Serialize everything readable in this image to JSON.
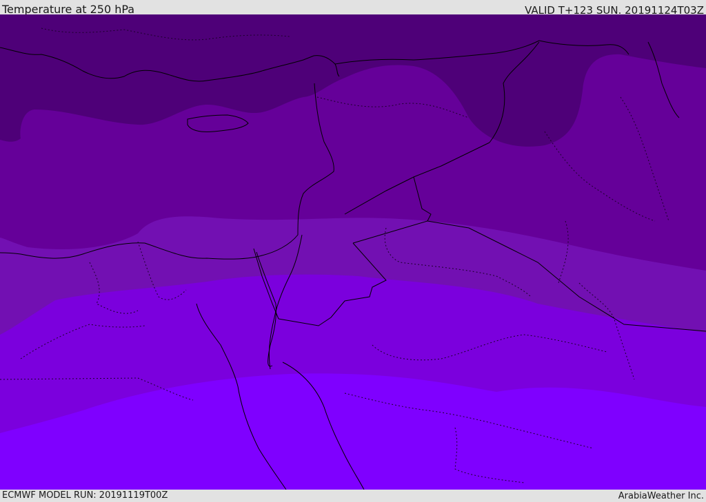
{
  "header": {
    "title": "Temperature at 250 hPa",
    "valid": "VALID T+123 SUN. 20191124T03Z"
  },
  "footer": {
    "model_run": "ECMWF MODEL RUN: 20191119T00Z",
    "credit": "ArabiaWeather Inc."
  },
  "map": {
    "variable": "temperature",
    "level": "250 hPa",
    "band_colors": [
      "#4e0078",
      "#650099",
      "#7210b2",
      "#7b00dd",
      "#7f00ff"
    ],
    "border_color": "#000000"
  }
}
